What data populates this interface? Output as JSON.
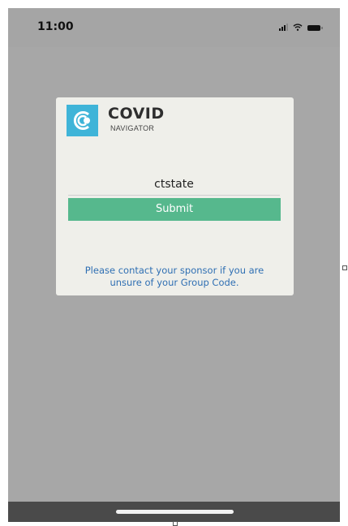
{
  "status_bar": {
    "time": "11:00",
    "icons": [
      "cellular-signal-icon",
      "wifi-icon",
      "battery-icon"
    ]
  },
  "card": {
    "logo": {
      "title": "COVID",
      "subtitle": "NAVIGATOR",
      "mark_color": "#3fb4d8"
    },
    "group_code": {
      "value": "ctstate"
    },
    "submit": {
      "label": "Submit",
      "color": "#56b88d"
    },
    "sponsor_note": "Please contact your sponsor if you are unsure of your Group Code."
  },
  "colors": {
    "background": "#a7a7a7",
    "card": "#efefea",
    "link": "#2f6fb3",
    "home_bar": "#4a4a4a"
  }
}
